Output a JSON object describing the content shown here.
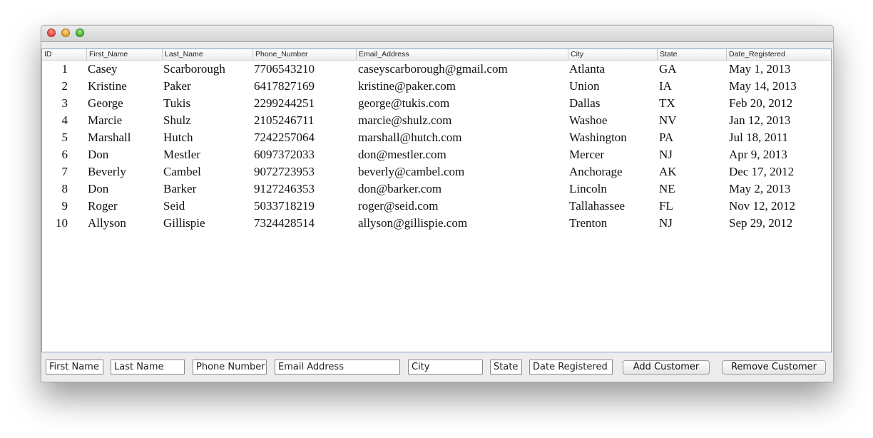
{
  "window": {
    "title": ""
  },
  "table": {
    "columns": [
      "ID",
      "First_Name",
      "Last_Name",
      "Phone_Number",
      "Email_Address",
      "City",
      "State",
      "Date_Registered"
    ],
    "rows": [
      [
        "1",
        "Casey",
        "Scarborough",
        "7706543210",
        "caseyscarborough@gmail.com",
        "Atlanta",
        "GA",
        "May 1, 2013"
      ],
      [
        "2",
        "Kristine",
        "Paker",
        "6417827169",
        "kristine@paker.com",
        "Union",
        "IA",
        "May 14, 2013"
      ],
      [
        "3",
        "George",
        "Tukis",
        "2299244251",
        "george@tukis.com",
        "Dallas",
        "TX",
        "Feb 20, 2012"
      ],
      [
        "4",
        "Marcie",
        "Shulz",
        "2105246711",
        "marcie@shulz.com",
        "Washoe",
        "NV",
        "Jan 12, 2013"
      ],
      [
        "5",
        "Marshall",
        "Hutch",
        "7242257064",
        "marshall@hutch.com",
        "Washington",
        "PA",
        "Jul 18, 2011"
      ],
      [
        "6",
        "Don",
        "Mestler",
        "6097372033",
        "don@mestler.com",
        "Mercer",
        "NJ",
        "Apr 9, 2013"
      ],
      [
        "7",
        "Beverly",
        "Cambel",
        "9072723953",
        "beverly@cambel.com",
        "Anchorage",
        "AK",
        "Dec 17, 2012"
      ],
      [
        "8",
        "Don",
        "Barker",
        "9127246353",
        "don@barker.com",
        "Lincoln",
        "NE",
        "May 2, 2013"
      ],
      [
        "9",
        "Roger",
        "Seid",
        "5033718219",
        "roger@seid.com",
        "Tallahassee",
        "FL",
        "Nov 12, 2012"
      ],
      [
        "10",
        "Allyson",
        "Gillispie",
        "7324428514",
        "allyson@gillispie.com",
        "Trenton",
        "NJ",
        "Sep 29, 2012"
      ]
    ]
  },
  "form": {
    "first_name": "First Name",
    "last_name": "Last Name",
    "phone_number": "Phone Number",
    "email_address": "Email Address",
    "city": "City",
    "state": "State",
    "date_registered": "Date Registered",
    "add_label": "Add Customer",
    "remove_label": "Remove Customer"
  },
  "colors": {
    "table_border": "#7f9fc8",
    "close": "#e2463f",
    "minimize": "#dfa128",
    "zoom": "#3fae2c"
  }
}
